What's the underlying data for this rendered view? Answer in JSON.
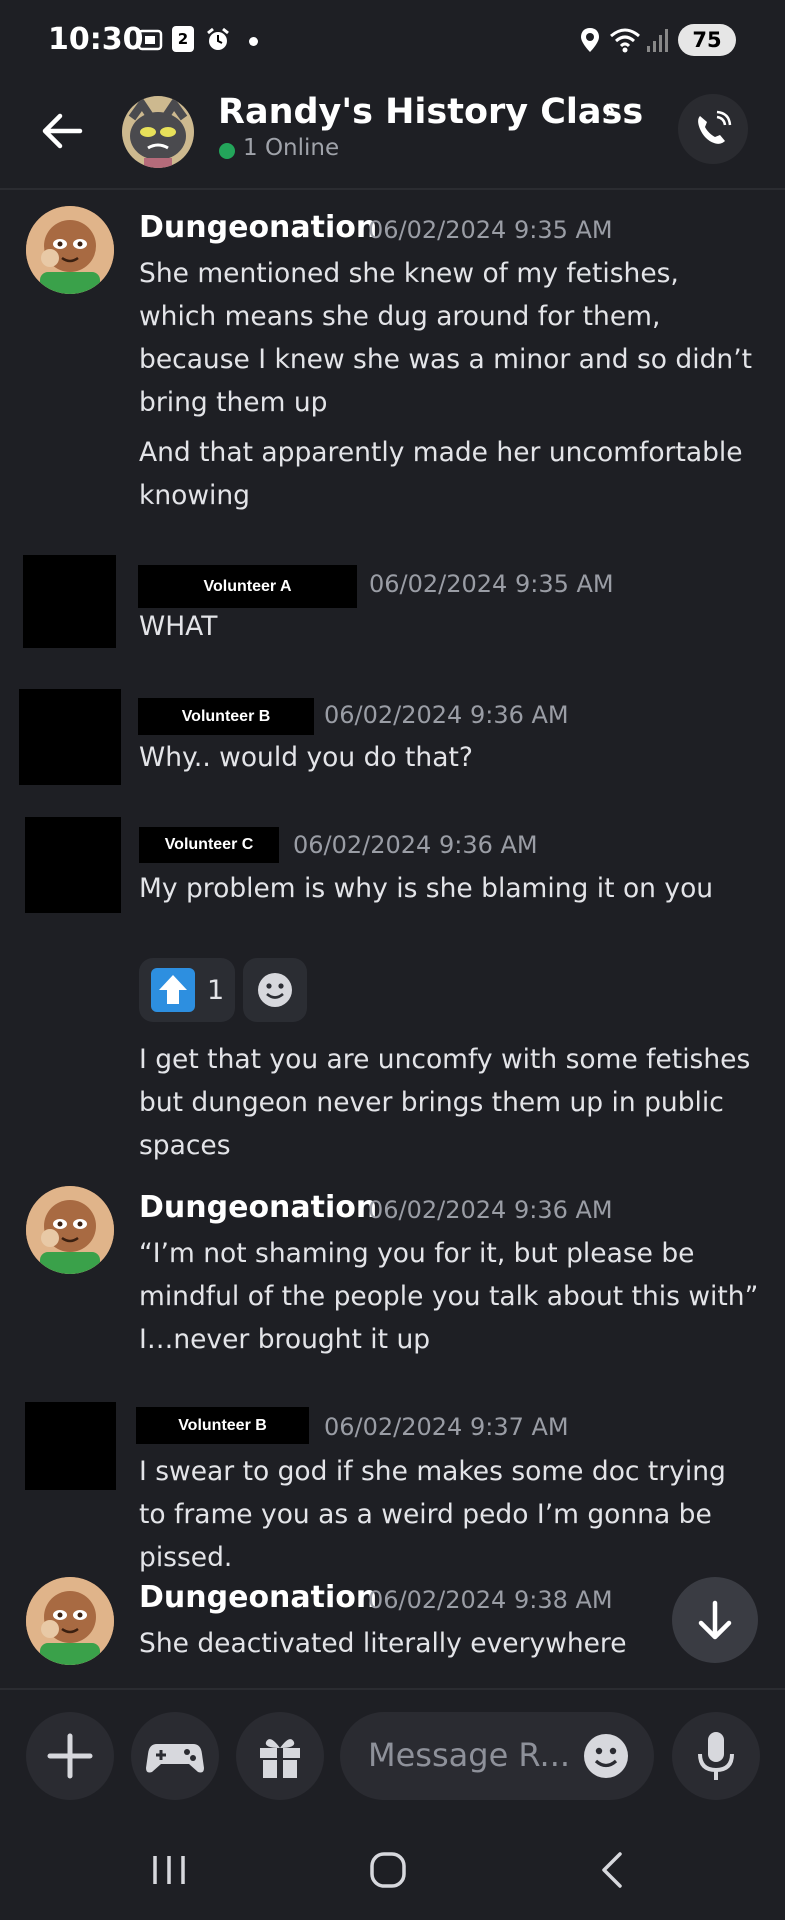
{
  "status_bar": {
    "time": "10:30",
    "notif_count": "2",
    "battery": "75"
  },
  "header": {
    "channel_name": "Randy's History Class",
    "online_text": "1 Online"
  },
  "messages": [
    {
      "author": "Dungeonation",
      "timestamp": "06/02/2024 9:35 AM",
      "lines": [
        "She mentioned she knew of my fetishes, which means she dug around for them, because I knew she was a minor and so didn’t bring them up",
        "And that apparently made her uncomfortable knowing"
      ]
    },
    {
      "author": "Volunteer A",
      "timestamp": "06/02/2024 9:35 AM",
      "lines": [
        "WHAT"
      ]
    },
    {
      "author": "Volunteer B",
      "timestamp": "06/02/2024 9:36 AM",
      "lines": [
        "Why.. would you do that?"
      ]
    },
    {
      "author": "Volunteer C",
      "timestamp": "06/02/2024 9:36 AM",
      "lines": [
        "My problem is why is she blaming it on you",
        "I get that you are uncomfy with some fetishes but dungeon never brings them up in public spaces"
      ],
      "reaction_count": "1"
    },
    {
      "author": "Dungeonation",
      "timestamp": "06/02/2024 9:36 AM",
      "lines": [
        "“I’m not shaming you for it, but please be mindful of the people you talk about this with”",
        "I…never brought it up"
      ]
    },
    {
      "author": "Volunteer B",
      "timestamp": "06/02/2024 9:37 AM",
      "lines": [
        "I swear to god if she makes some doc trying to frame you as a weird pedo I’m gonna be pissed."
      ]
    },
    {
      "author": "Dungeonation",
      "timestamp": "06/02/2024 9:38 AM",
      "lines": [
        "She deactivated literally everywhere"
      ]
    }
  ],
  "composer": {
    "placeholder": "Message R..."
  },
  "colors": {
    "background": "#1e1f24",
    "online": "#23a55a",
    "upvote": "#2d8fe0",
    "name_redaction": "#000000"
  },
  "icons": [
    "back-arrow-icon",
    "phone-settings-icon",
    "arrow-down-icon",
    "plus-icon",
    "gamepad-icon",
    "gift-icon",
    "emoji-icon",
    "mic-icon",
    "upvote-icon"
  ]
}
